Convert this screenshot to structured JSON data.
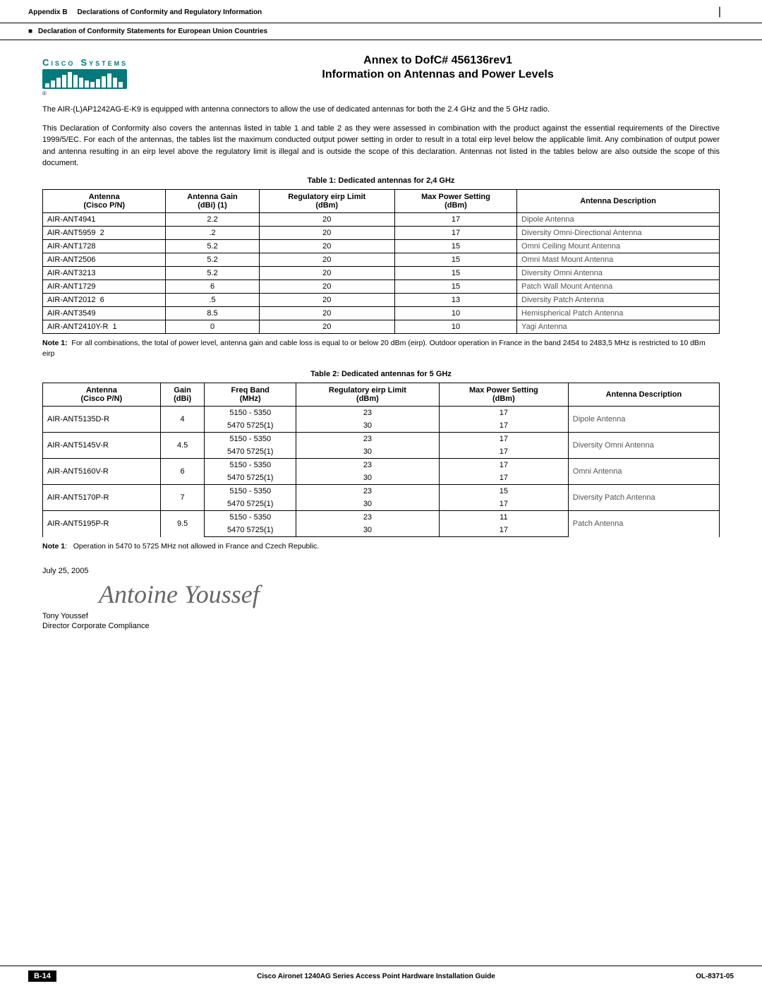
{
  "header": {
    "appendix": "Appendix B",
    "title": "Declarations of Conformity and Regulatory Information",
    "declaration": "Declaration of Conformity Statements for European Union Countries"
  },
  "cisco_logo": {
    "text": "Cisco Systems",
    "registered": "®"
  },
  "annex": {
    "line1": "Annex to DofC# 456136rev1",
    "line2": "Information on Antennas and Power Levels"
  },
  "body": {
    "para1": "The AIR-(L)AP1242AG-E-K9 is equipped with antenna connectors to allow the use of dedicated antennas for both the 2.4 GHz and the 5 GHz radio.",
    "para2": "This Declaration of Conformity also covers the antennas listed in table 1 and table 2 as they were assessed in combination with the product against the essential requirements of the Directive 1999/5/EC. For each of the antennas, the tables list the maximum conducted output power setting in order to result in a total eirp level below the applicable limit. Any combination of output power and antenna resulting in an eirp level above the regulatory limit is illegal and is outside the scope of this declaration. Antennas not listed in the tables below are also outside the scope of this document."
  },
  "table1": {
    "title": "Table 1: Dedicated antennas for 2,4 GHz",
    "headers": {
      "col1": "Antenna",
      "col1sub": "(Cisco P/N)",
      "col2": "Antenna Gain",
      "col2sub": "(dBi) (1)",
      "col3": "Regulatory eirp Limit",
      "col3sub": "(dBm)",
      "col4": "Max Power Setting",
      "col4sub": "(dBm)",
      "col5": "Antenna Description"
    },
    "rows": [
      {
        "pn": "AIR-ANT4941",
        "suffix": "",
        "gain": "2.2",
        "eirp": "20",
        "maxpwr": "17",
        "desc": "Dipole Antenna"
      },
      {
        "pn": "AIR-ANT5959",
        "suffix": "2",
        "gain": ".2",
        "eirp": "20",
        "maxpwr": "17",
        "desc": "Diversity Omni-Directional Antenna"
      },
      {
        "pn": "AIR-ANT1728",
        "suffix": "",
        "gain": "5.2",
        "eirp": "20",
        "maxpwr": "15",
        "desc": "Omni Ceiling Mount Antenna"
      },
      {
        "pn": "AIR-ANT2506",
        "suffix": "",
        "gain": "5.2",
        "eirp": "20",
        "maxpwr": "15",
        "desc": "Omni Mast Mount Antenna"
      },
      {
        "pn": "AIR-ANT3213",
        "suffix": "",
        "gain": "5.2",
        "eirp": "20",
        "maxpwr": "15",
        "desc": "Diversity Omni Antenna"
      },
      {
        "pn": "AIR-ANT1729",
        "suffix": "",
        "gain": "6",
        "eirp": "20",
        "maxpwr": "15",
        "desc": "Patch Wall Mount Antenna"
      },
      {
        "pn": "AIR-ANT2012",
        "suffix": "6",
        "gain": ".5",
        "eirp": "20",
        "maxpwr": "13",
        "desc": "Diversity Patch Antenna"
      },
      {
        "pn": "AIR-ANT3549",
        "suffix": "",
        "gain": "8.5",
        "eirp": "20",
        "maxpwr": "10",
        "desc": "Hemispherical Patch Antenna"
      },
      {
        "pn": "AIR-ANT2410Y-R",
        "suffix": "1",
        "gain": "0",
        "eirp": "20",
        "maxpwr": "10",
        "desc": "Yagi Antenna"
      }
    ],
    "note": "Note 1:  For all combinations, the total of power level, antenna gain and cable loss is equal to or below 20 dBm (eirp). Outdoor operation in France in the band 2454 to 2483,5 MHz is restricted to 10 dBm eirp"
  },
  "table2": {
    "title": "Table 2: Dedicated antennas for 5 GHz",
    "headers": {
      "col1": "Antenna",
      "col1sub": "(Cisco P/N)",
      "col2": "Gain",
      "col2sub": "(dBi)",
      "col3": "Freq Band",
      "col3sub": "(MHz)",
      "col4": "Regulatory eirp Limit",
      "col4sub": "(dBm)",
      "col5": "Max Power Setting",
      "col5sub": "(dBm)",
      "col6": "Antenna Description"
    },
    "rows": [
      {
        "pn": "AIR-ANT5135D-R",
        "gain": "4",
        "bands": [
          "5150 - 5350",
          "5470   5725(1)"
        ],
        "eirps": [
          "23",
          "30"
        ],
        "maxpwrs": [
          "17",
          "17"
        ],
        "desc": "Dipole Antenna"
      },
      {
        "pn": "AIR-ANT5145V-R",
        "gain": "4.5",
        "bands": [
          "5150 - 5350",
          "5470   5725(1)"
        ],
        "eirps": [
          "23",
          "30"
        ],
        "maxpwrs": [
          "17",
          "17"
        ],
        "desc": "Diversity Omni Antenna"
      },
      {
        "pn": "AIR-ANT5160V-R",
        "gain": "6",
        "bands": [
          "5150 - 5350",
          "5470   5725(1)"
        ],
        "eirps": [
          "23",
          "30"
        ],
        "maxpwrs": [
          "17",
          "17"
        ],
        "desc": "Omni Antenna"
      },
      {
        "pn": "AIR-ANT5170P-R",
        "gain": "7",
        "bands": [
          "5150 - 5350",
          "5470   5725(1)"
        ],
        "eirps": [
          "23",
          "30"
        ],
        "maxpwrs": [
          "15",
          "17"
        ],
        "desc": "Diversity Patch Antenna"
      },
      {
        "pn": "AIR-ANT5195P-R",
        "gain": "9.5",
        "bands": [
          "5150 - 5350",
          "5470   5725(1)"
        ],
        "eirps": [
          "23",
          "30"
        ],
        "maxpwrs": [
          "11",
          "17"
        ],
        "desc": "Patch Antenna"
      }
    ],
    "note": "Note 1:   Operation in 5470 to 5725 MHz not allowed in France and Czech Republic."
  },
  "signature": {
    "date": "July 25, 2005",
    "name": "Tony Youssef",
    "title": "Director Corporate Compliance"
  },
  "footer": {
    "page_label": "B-14",
    "book_title": "Cisco Aironet 1240AG Series Access Point Hardware Installation Guide",
    "doc_id": "OL-8371-05"
  }
}
